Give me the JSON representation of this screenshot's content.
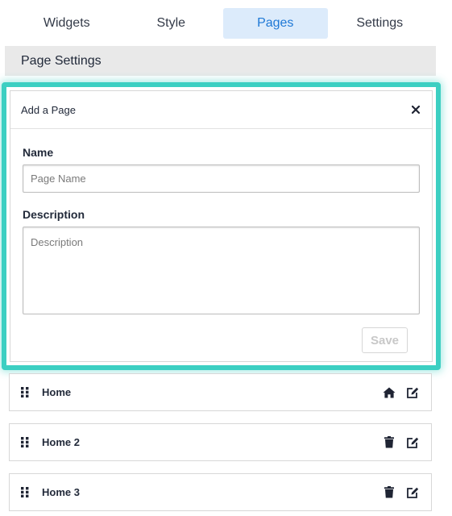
{
  "tabs": [
    {
      "label": "Widgets",
      "active": false
    },
    {
      "label": "Style",
      "active": false
    },
    {
      "label": "Pages",
      "active": true
    },
    {
      "label": "Settings",
      "active": false
    }
  ],
  "section": {
    "title": "Page Settings"
  },
  "add_page": {
    "title": "Add a Page",
    "name_label": "Name",
    "name_placeholder": "Page Name",
    "name_value": "",
    "description_label": "Description",
    "description_placeholder": "Description",
    "description_value": "",
    "save_label": "Save"
  },
  "pages": [
    {
      "name": "Home",
      "actions": [
        "home-icon",
        "edit-icon"
      ]
    },
    {
      "name": "Home 2",
      "actions": [
        "trash-icon",
        "edit-icon"
      ]
    },
    {
      "name": "Home 3",
      "actions": [
        "trash-icon",
        "edit-icon"
      ]
    }
  ],
  "colors": {
    "accent": "#1e78d6",
    "active_tab_bg": "#dcebfb",
    "highlight_border": "#3ccfc2",
    "text": "#222a3a"
  }
}
